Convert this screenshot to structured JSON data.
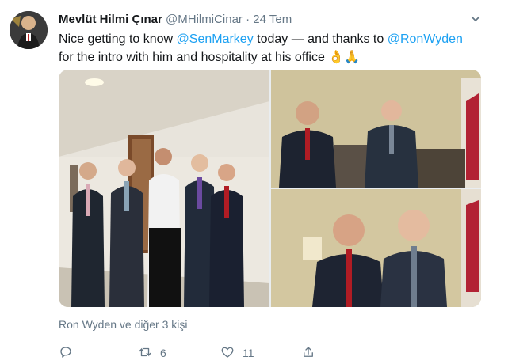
{
  "tweet": {
    "display_name": "Mevlüt Hilmi Çınar",
    "handle": "@MHilmiCinar",
    "separator": "·",
    "time": "24 Tem",
    "text_parts": {
      "p1": "Nice getting to know ",
      "m1": "@SenMarkey",
      "p2": " today — and thanks to ",
      "m2": "@RonWyden",
      "p3": " for the intro with him and hospitality at his office ",
      "emoji": "👌🙏"
    },
    "liked_by": "Ron Wyden ve diğer 3 kişi",
    "actions": {
      "reply_count": "",
      "retweet_count": "6",
      "like_count": "11"
    }
  },
  "icons": {
    "chevron": "chevron-down-icon",
    "reply": "reply-icon",
    "retweet": "retweet-icon",
    "like": "heart-icon",
    "share": "share-icon"
  },
  "colors": {
    "link": "#1da1f2",
    "secondary_text": "#657786",
    "primary_text": "#14171a"
  }
}
